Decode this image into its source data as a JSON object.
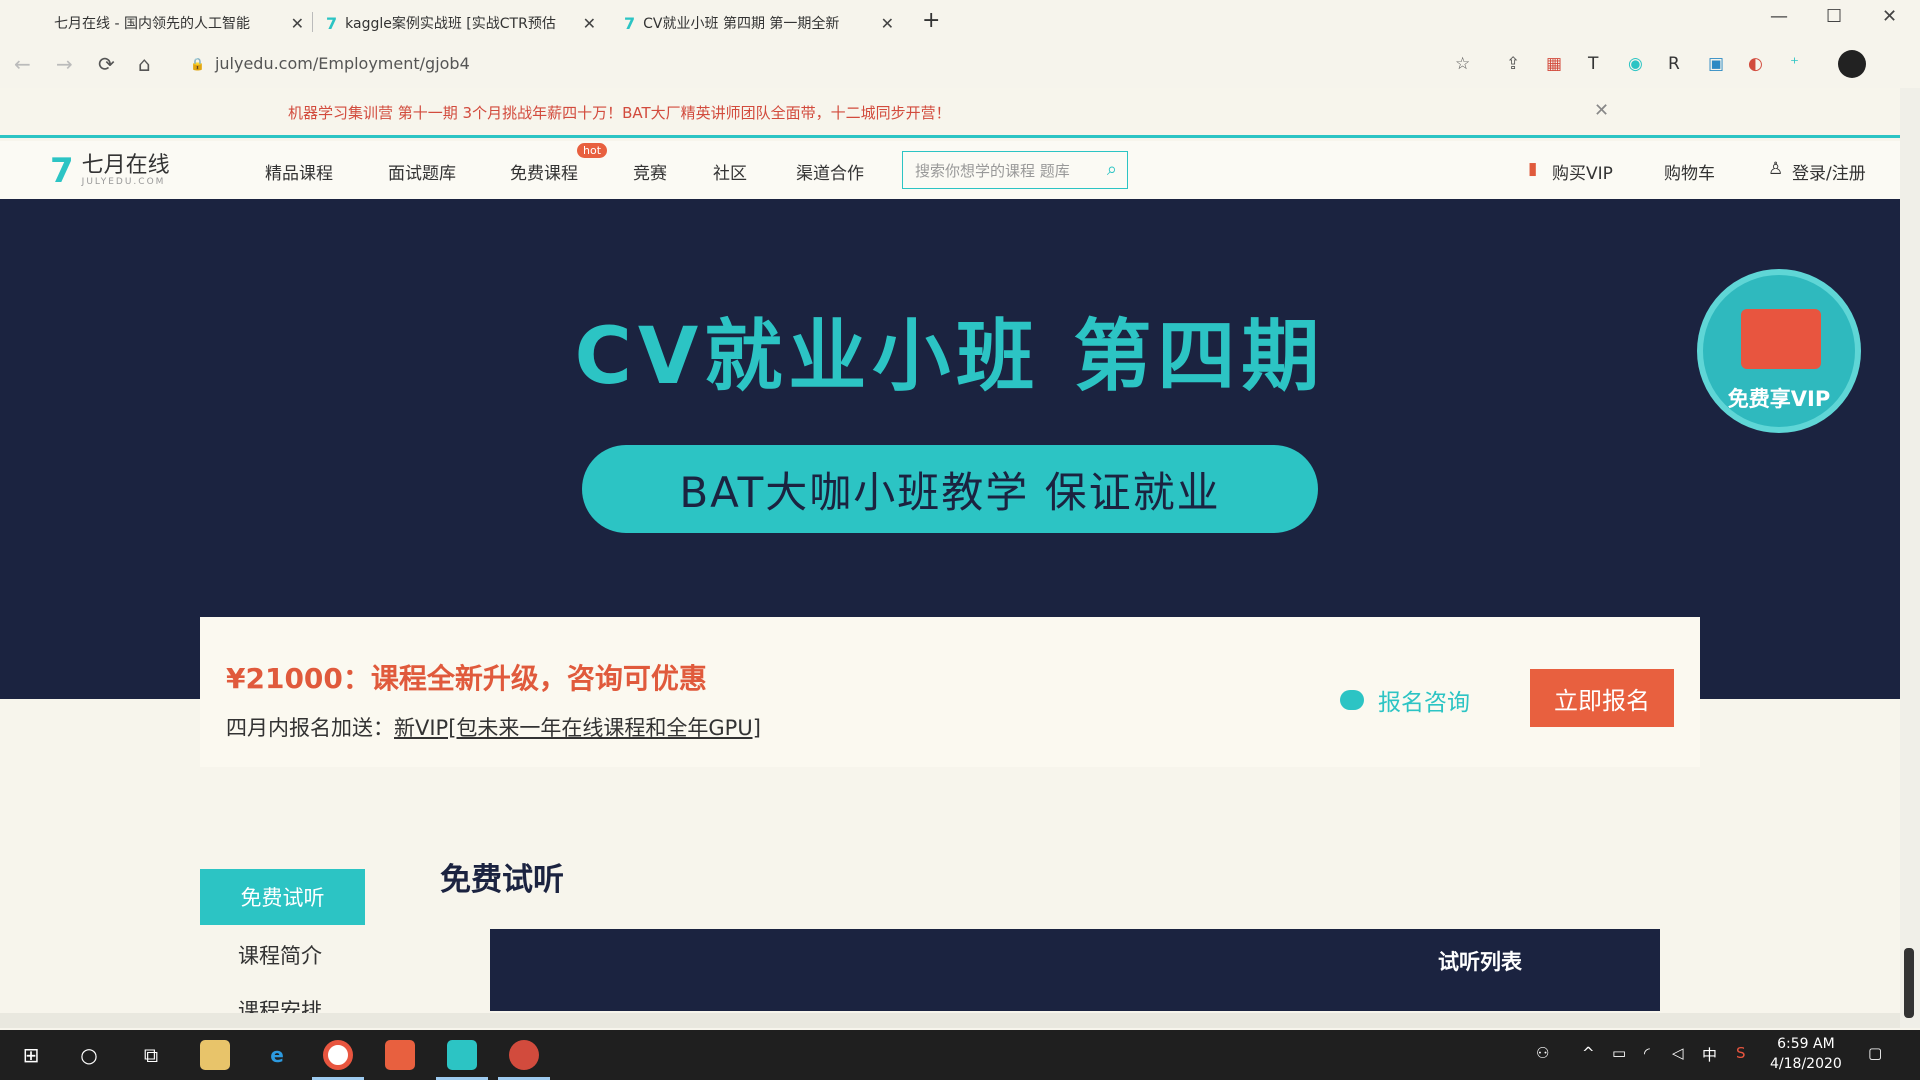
{
  "browser": {
    "tabs": [
      {
        "title": "七月在线 - 国内领先的人工智能",
        "close": "✕"
      },
      {
        "title": "kaggle案例实战班 [实战CTR预估",
        "close": "✕"
      },
      {
        "title": "CV就业小班 第四期 第一期全新",
        "close": "✕"
      }
    ],
    "new_tab": "+",
    "url": "julyedu.com/Employment/gjob4"
  },
  "notice": {
    "text": "机器学习集训营 第十一期   3个月挑战年薪四十万！BAT大厂精英讲师团队全面带，十二城同步开营！",
    "close": "✕"
  },
  "site": {
    "logo_cn": "七月在线",
    "logo_en": "JULYEDU.COM",
    "nav": [
      "精品课程",
      "面试题库",
      "免费课程",
      "竞赛",
      "社区",
      "渠道合作"
    ],
    "hot_badge": "hot",
    "search_placeholder": "搜索你想学的课程 题库",
    "right": {
      "vip": "购买VIP",
      "cart": "购物车",
      "login": "登录/注册"
    }
  },
  "hero": {
    "title": "CV就业小班 第四期",
    "pill": "BAT大咖小班教学  保证就业",
    "vip_badge": "免费享VIP"
  },
  "pricecard": {
    "price": "¥21000：课程全新升级，咨询可优惠",
    "gift_prefix": "四月内报名加送：",
    "gift_link": "新VIP[包未来一年在线课程和全年GPU]",
    "consult": "报名咨询",
    "enroll": "立即报名"
  },
  "sidenav": {
    "active": "免费试听",
    "items": [
      "课程简介",
      "课程安排"
    ]
  },
  "content": {
    "section_title": "免费试听",
    "trial_list": "试听列表"
  },
  "taskbar": {
    "time": "6:59 AM",
    "date": "4/18/2020",
    "ime": "中"
  },
  "colors": {
    "accent": "#2cc4c4",
    "hero_bg": "#1b2340",
    "cta": "#e8603f",
    "price": "#e05a3c"
  }
}
